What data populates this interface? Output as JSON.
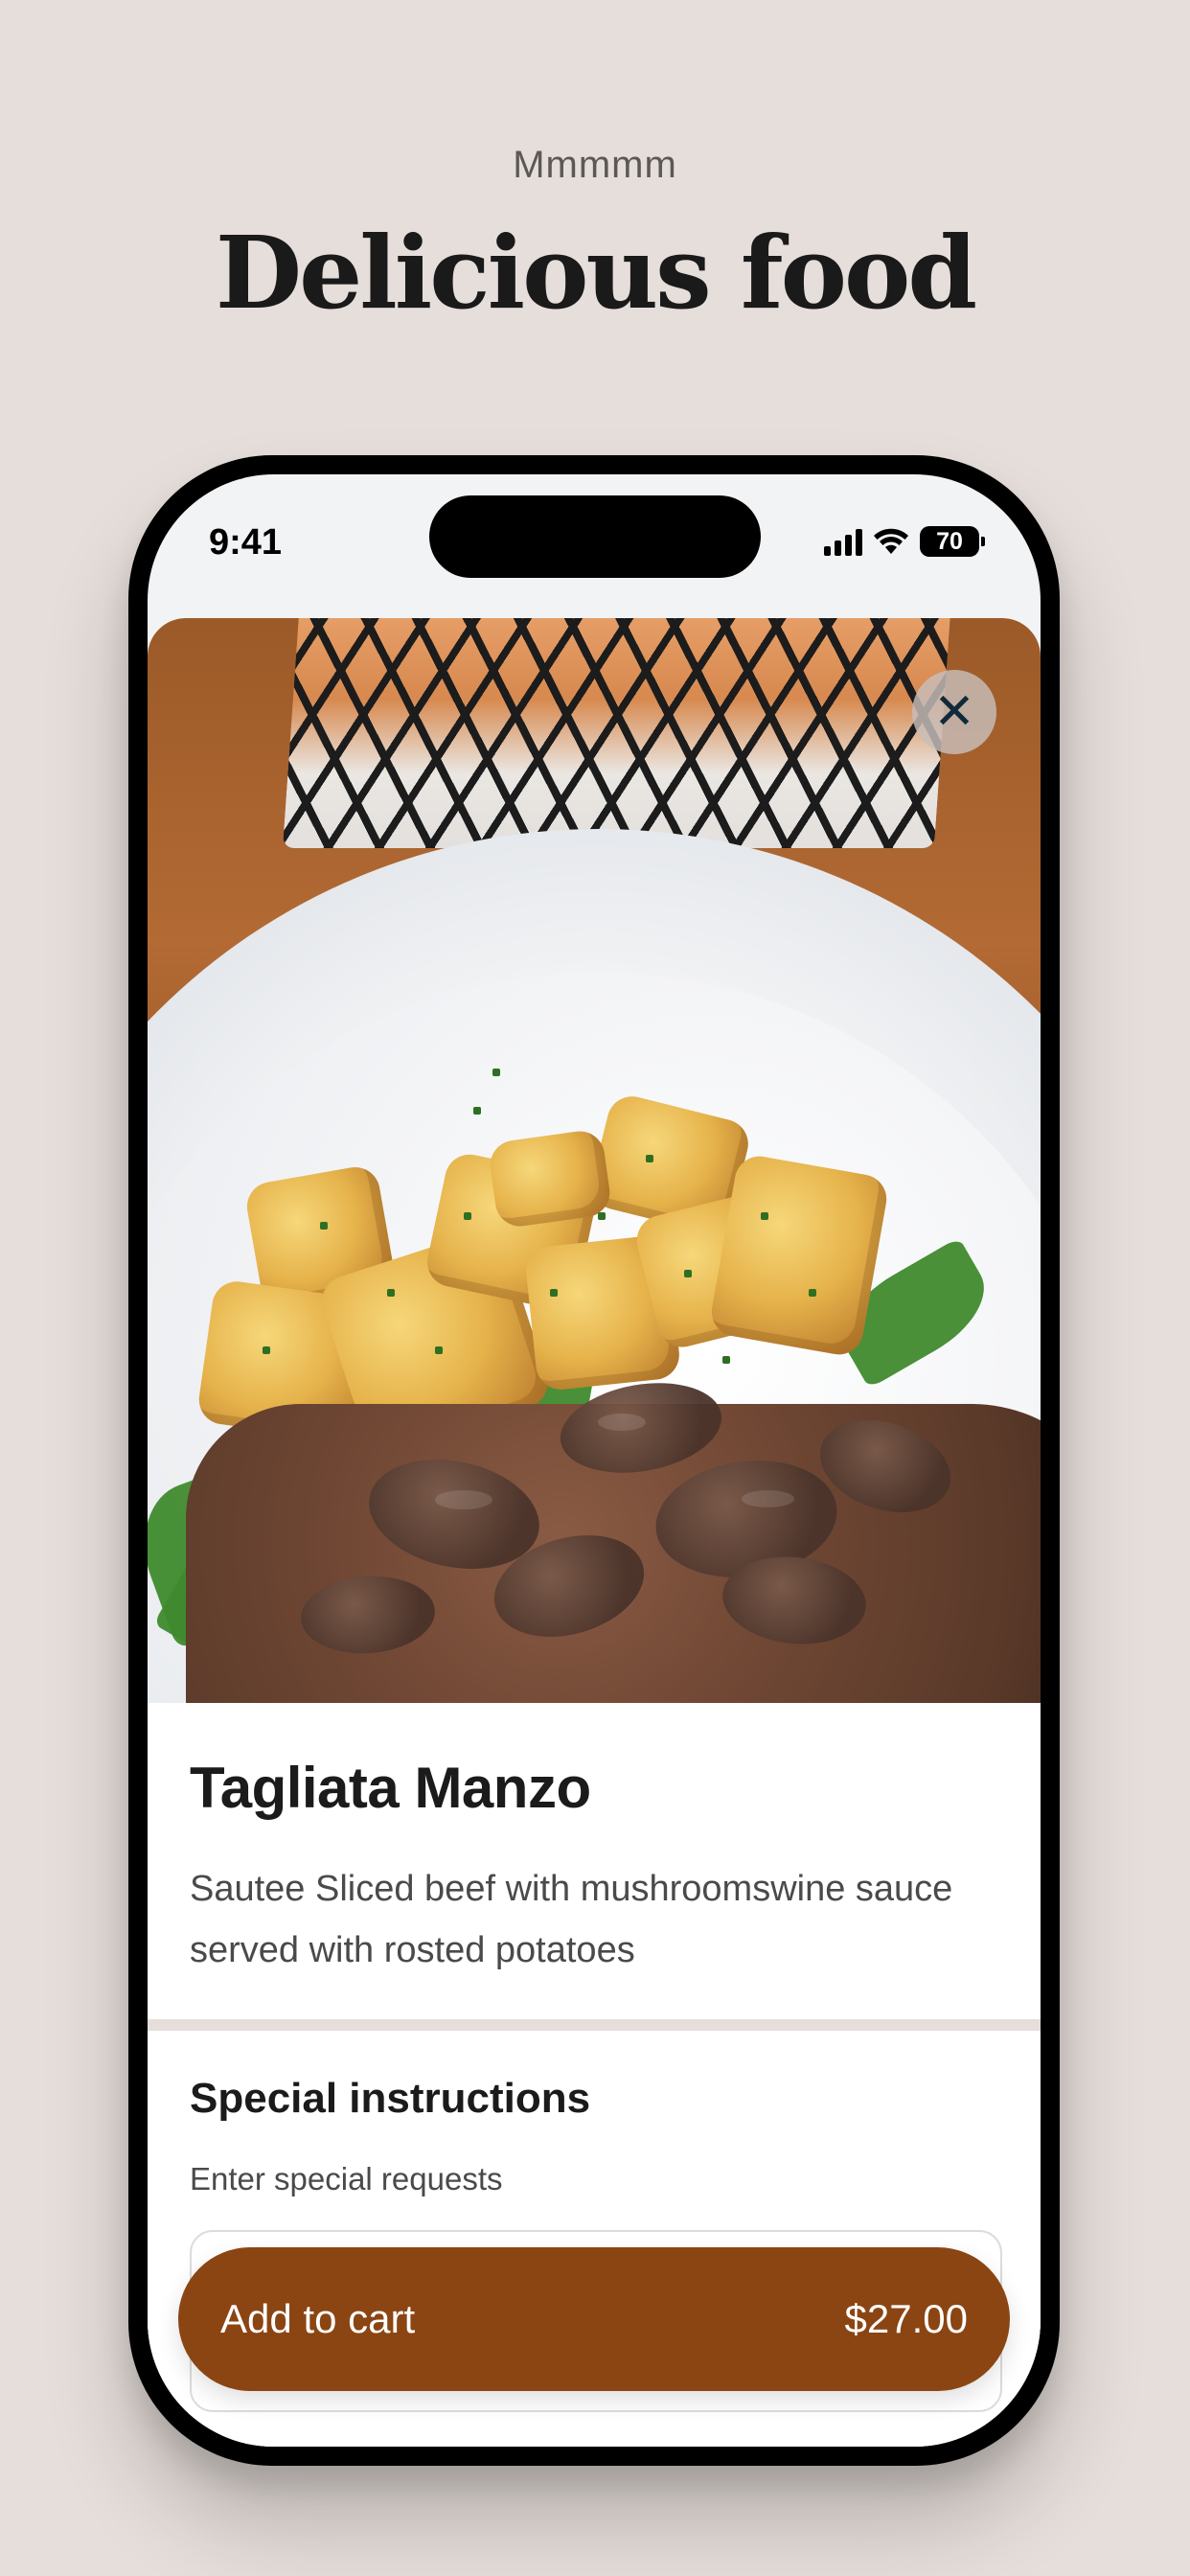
{
  "hero": {
    "eyebrow": "Mmmmm",
    "title": "Delicious food"
  },
  "status_bar": {
    "time": "9:41",
    "battery": "70",
    "icons": [
      "signal-icon",
      "wifi-icon",
      "battery-icon"
    ]
  },
  "dish": {
    "image_icon": "food-photo",
    "close_icon": "close-icon",
    "close_symbol": "✕",
    "name": "Tagliata Manzo",
    "description": "Sautee Sliced beef with mushroomswine sauce served with rosted potatoes"
  },
  "instructions": {
    "title": "Special instructions",
    "subtitle": "Enter special requests",
    "input_value": ""
  },
  "cart": {
    "label": "Add to cart",
    "price": "$27.00"
  },
  "colors": {
    "background": "#e6deda",
    "accent": "#8b4513"
  }
}
